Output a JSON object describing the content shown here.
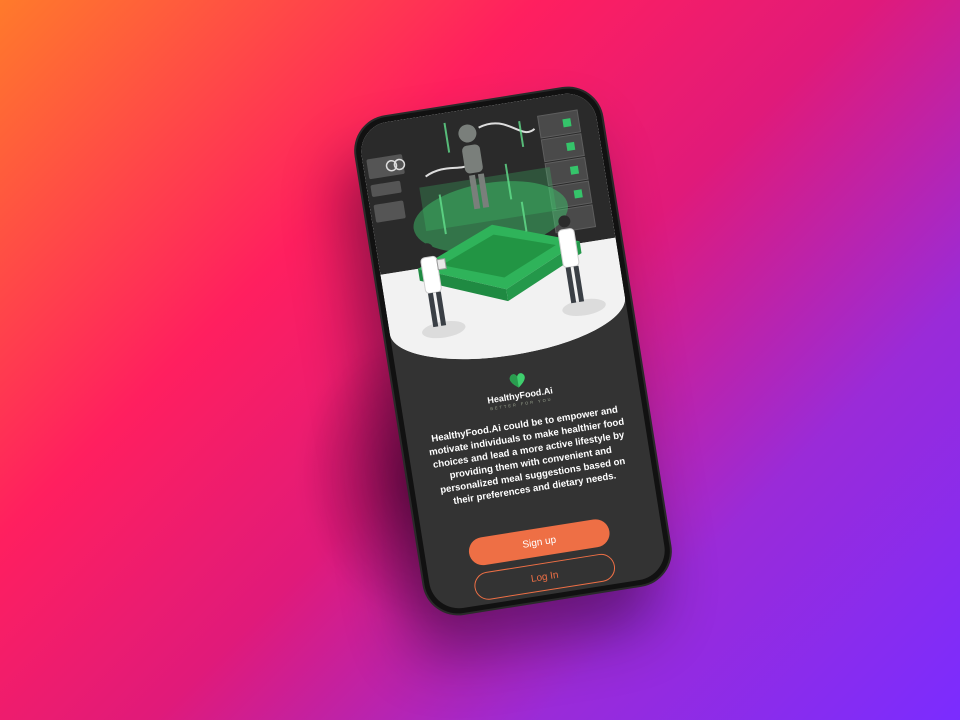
{
  "app": {
    "name": "HealthyFood.Ai",
    "tagline": "BETTER FOR YOU",
    "description": "HealthyFood.Ai could be to empower and motivate individuals to make healthier food choices and lead a more active lifestyle by providing them with convenient and personalized meal suggestions based on their preferences and dietary needs."
  },
  "buttons": {
    "signup_label": "Sign up",
    "login_label": "Log In"
  },
  "colors": {
    "accent": "#ee6f45",
    "screen_bg": "#333333",
    "illustration_green": "#2fb35a"
  }
}
